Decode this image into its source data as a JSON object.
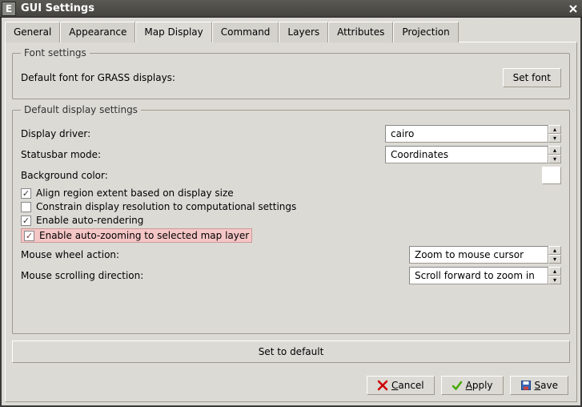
{
  "titlebar": {
    "app_letter": "E",
    "title": "GUI Settings"
  },
  "tabs": {
    "general": "General",
    "appearance": "Appearance",
    "map_display": "Map Display",
    "command": "Command",
    "layers": "Layers",
    "attributes": "Attributes",
    "projection": "Projection"
  },
  "font_settings": {
    "legend": "Font settings",
    "default_font_label": "Default font for GRASS displays:",
    "set_font_button": "Set font"
  },
  "display_settings": {
    "legend": "Default display settings",
    "driver_label": "Display driver:",
    "driver_value": "cairo",
    "statusbar_label": "Statusbar mode:",
    "statusbar_value": "Coordinates",
    "bg_color_label": "Background color:",
    "bg_color_value": "#ffffff",
    "check_align": "Align region extent based on display size",
    "check_constrain": "Constrain display resolution to computational settings",
    "check_autorender": "Enable auto-rendering",
    "check_autozoom": "Enable auto-zooming to selected map layer",
    "wheel_label": "Mouse wheel action:",
    "wheel_value": "Zoom to mouse cursor",
    "scroll_label": "Mouse scrolling direction:",
    "scroll_value": "Scroll forward to zoom in"
  },
  "buttons": {
    "set_default": "Set to default",
    "cancel": "Cancel",
    "apply": "Apply",
    "save": "Save"
  },
  "checked": {
    "align": true,
    "constrain": false,
    "autorender": true,
    "autozoom": true
  }
}
